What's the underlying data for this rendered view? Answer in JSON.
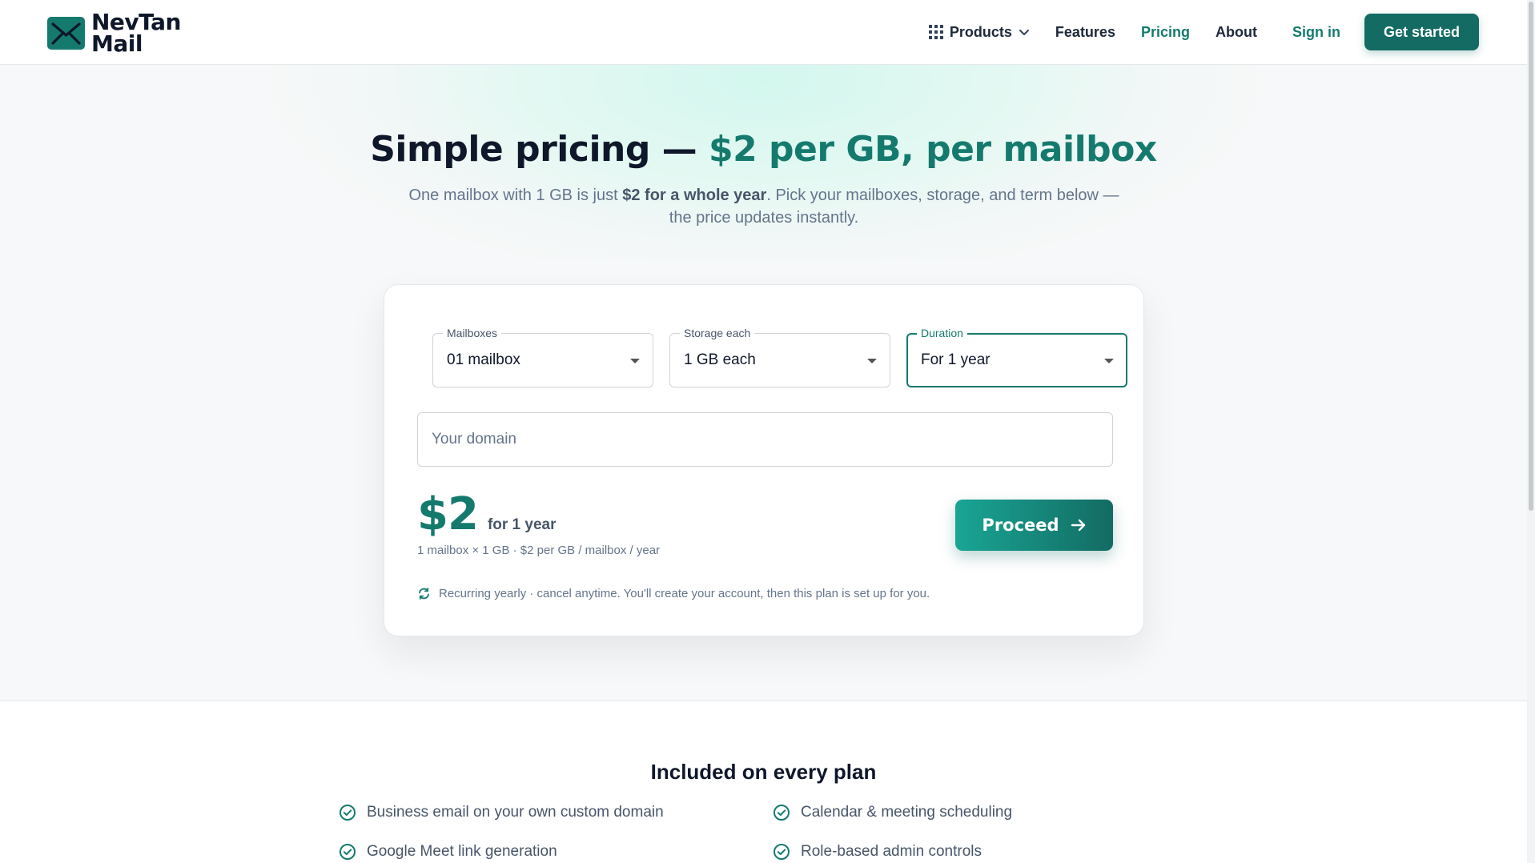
{
  "brand": {
    "line1": "NevTan",
    "line2": "Mail",
    "logo_icon": "envelope-icon",
    "accent": "#157a6e"
  },
  "nav": {
    "products": "Products",
    "features": "Features",
    "pricing": "Pricing",
    "about": "About",
    "sign_in": "Sign in",
    "get_started": "Get started"
  },
  "hero": {
    "title_main": "Simple pricing — ",
    "title_accent": "$2 per GB, per mailbox",
    "sub_before": "One mailbox with 1 GB is just ",
    "sub_bold": "$2 for a whole year",
    "sub_after": ". Pick your mailboxes, storage, and term below — the price updates instantly."
  },
  "calculator": {
    "mailboxes": {
      "label": "Mailboxes",
      "value": "01 mailbox"
    },
    "storage": {
      "label": "Storage each",
      "value": "1 GB each"
    },
    "duration": {
      "label": "Duration",
      "value": "For 1 year"
    },
    "domain_placeholder": "Your domain",
    "price": "$2",
    "price_term": "for 1 year",
    "breakdown": "1 mailbox × 1 GB · $2 per GB / mailbox / year",
    "proceed": "Proceed",
    "recurring_note": "Recurring yearly · cancel anytime. You'll create your account, then this plan is set up for you."
  },
  "included": {
    "title": "Included on every plan",
    "items": [
      "Business email on your own custom domain",
      "Calendar & meeting scheduling",
      "Google Meet link generation",
      "Role-based admin controls"
    ]
  }
}
